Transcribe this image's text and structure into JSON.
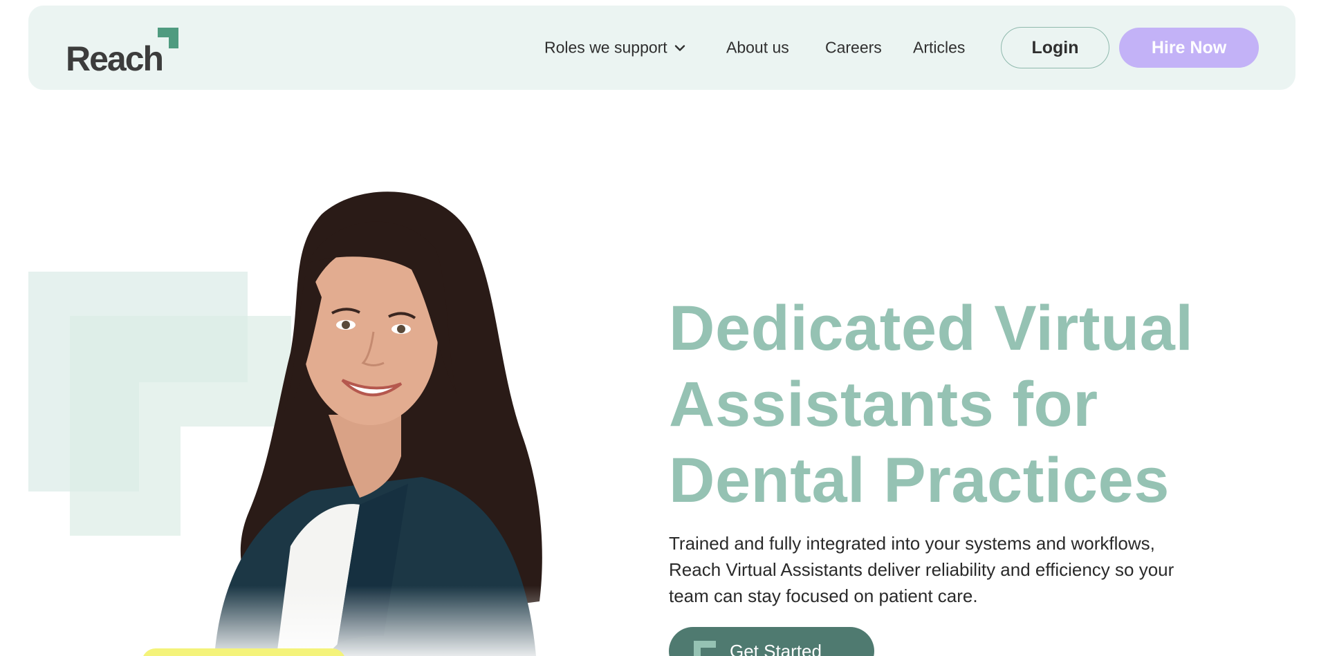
{
  "header": {
    "logo_text": "Reach",
    "nav": [
      {
        "label": "Roles we support",
        "has_dropdown": true
      },
      {
        "label": "About us"
      },
      {
        "label": "Careers"
      },
      {
        "label": "Articles"
      }
    ],
    "login_label": "Login",
    "hire_label": "Hire Now"
  },
  "hero": {
    "headline_lines": [
      "Dedicated Virtual",
      "Assistants for",
      "Dental Practices"
    ],
    "subtext_lines": [
      "Trained and fully integrated into your systems and workflows,",
      "Reach Virtual Assistants deliver reliability and efficiency so your",
      "team can stay focused on patient care."
    ],
    "cta_label": "Get Started"
  },
  "colors": {
    "header_bg": "#ebf4f2",
    "brand_green": "#4f9b80",
    "headline": "#95c2b3",
    "hire_button": "#c3b2f7",
    "cta_button": "#4f7a70",
    "accent_yellow": "#f4f37a"
  },
  "icons": [
    "reach-logo-mark-icon",
    "chevron-down-icon",
    "get-started-bracket-icon"
  ]
}
